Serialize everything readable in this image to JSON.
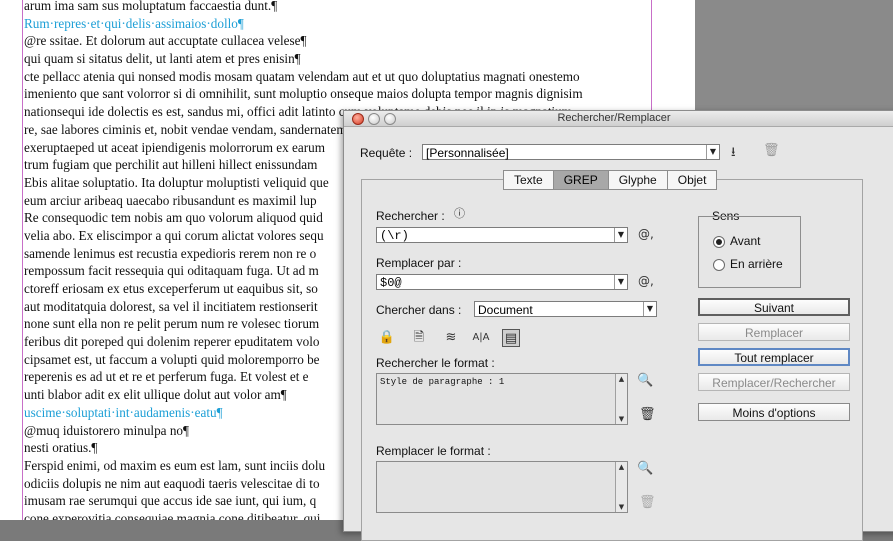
{
  "document": {
    "lines": [
      {
        "text": "arum ima sam sus moluptatum faccaestia dunt.¶",
        "style": "body"
      },
      {
        "text": "Rum·repres·et·qui·delis·assimaios·dollo¶",
        "style": "blue"
      },
      {
        "text": "@re ssitae. Et dolorum aut accuptate cullacea velese¶",
        "style": "body"
      },
      {
        "text": "qui quam si sitatus delit, ut lanti atem et pres enisin¶",
        "style": "body"
      },
      {
        "text": "cte pellacc atenia qui nonsed modis mosam quatam velendam aut et ut quo doluptatius magnati onestemo",
        "style": "body"
      },
      {
        "text": "imeniento que sant volorror si di omnihilit, sunt moluptio onseque maios dolupta tempor magnis dignisim",
        "style": "body"
      },
      {
        "text": "nationsequi ide dolectis es est, sandus mi, offici adit latinto cum voluptame debis nos il ip is magnatium",
        "style": "body"
      },
      {
        "text": "re, sae labores ciminis et, nobit vendae vendam, sandernatem",
        "style": "body"
      },
      {
        "text": "exeruptaeped ut aceat ipiendigenis molorrorum ex earum",
        "style": "body"
      },
      {
        "text": "trum fugiam que perchilit aut hilleni hillect enissundam",
        "style": "body"
      },
      {
        "text": "Ebis alitae soluptatio. Ita doluptur moluptisti veliquid que",
        "style": "body"
      },
      {
        "text": "eum arciur aribeaq uaecabo ribusandunt es maximil lup",
        "style": "body"
      },
      {
        "text": "Re consequodic tem nobis am quo volorum aliquod quid",
        "style": "body"
      },
      {
        "text": "velia abo. Ex eliscimpor a qui corum alictat volores sequ",
        "style": "body"
      },
      {
        "text": "samende lenimus est recustia expedioris rerem non re o",
        "style": "body"
      },
      {
        "text": "rempossum facit ressequia qui oditaquam fuga. Ut ad m",
        "style": "body"
      },
      {
        "text": "ctoreff eriosam ex etus exceperferum ut eaquibus sit, so",
        "style": "body"
      },
      {
        "text": "aut moditatquia dolorest, sa vel il incitiatem restionserit",
        "style": "body"
      },
      {
        "text": "none sunt ella non re pelit perum num re volesec tiorum",
        "style": "body"
      },
      {
        "text": "feribus dit poreped qui dolenim reperer epuditatem volo",
        "style": "body"
      },
      {
        "text": "cipsamet est, ut faccum a volupti quid moloremporro be",
        "style": "body"
      },
      {
        "text": "reperenis es ad ut et re et perferum fuga. Et volest et e",
        "style": "body"
      },
      {
        "text": "unti blabor adit ex elit ullique dolut aut volor am¶",
        "style": "body"
      },
      {
        "text": "uscime·soluptati·int·audamenis·eatu¶",
        "style": "blue"
      },
      {
        "text": "@muq iduistorero minulpa no¶",
        "style": "body"
      },
      {
        "text": "nesti oratius.¶",
        "style": "body"
      },
      {
        "text": "Ferspid enimi, od maxim es eum est lam, sunt inciis dolu",
        "style": "body"
      },
      {
        "text": "odiciis dolupis ne nim aut eaquodi taeris velescitae di to",
        "style": "body"
      },
      {
        "text": "imusam rae serumqui que accus ide sae iunt, qui ium, q",
        "style": "body"
      },
      {
        "text": "cone experovitia consequiae magnia cone ditibeatur, qui",
        "style": "body"
      }
    ]
  },
  "dialog": {
    "title": "Rechercher/Remplacer",
    "query_label": "Requête :",
    "query_value": "[Personnalisée]",
    "tabs": [
      {
        "label": "Texte",
        "active": false
      },
      {
        "label": "GREP",
        "active": true
      },
      {
        "label": "Glyphe",
        "active": false
      },
      {
        "label": "Objet",
        "active": false
      }
    ],
    "find_label": "Rechercher :",
    "find_value": "(\\r)",
    "replace_label": "Remplacer par :",
    "replace_value": "$0@",
    "search_in_label": "Chercher dans :",
    "search_in_value": "Document",
    "find_format_label": "Rechercher le format :",
    "find_format_value": "Style de paragraphe : 1",
    "replace_format_label": "Remplacer le format :",
    "replace_format_value": "",
    "direction": {
      "label": "Sens",
      "options": [
        {
          "label": "Avant",
          "selected": true
        },
        {
          "label": "En arrière",
          "selected": false
        }
      ]
    },
    "buttons": {
      "next": "Suivant",
      "replace": "Remplacer",
      "replace_all": "Tout remplacer",
      "replace_find": "Remplacer/Rechercher",
      "fewer_options": "Moins d'options"
    }
  }
}
